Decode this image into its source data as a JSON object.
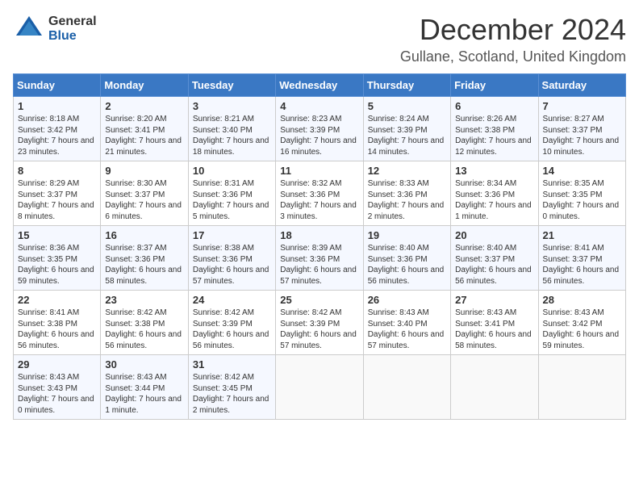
{
  "header": {
    "logo_general": "General",
    "logo_blue": "Blue",
    "title": "December 2024",
    "subtitle": "Gullane, Scotland, United Kingdom"
  },
  "calendar": {
    "days_of_week": [
      "Sunday",
      "Monday",
      "Tuesday",
      "Wednesday",
      "Thursday",
      "Friday",
      "Saturday"
    ],
    "weeks": [
      [
        {
          "day": "1",
          "sunrise": "Sunrise: 8:18 AM",
          "sunset": "Sunset: 3:42 PM",
          "daylight": "Daylight: 7 hours and 23 minutes."
        },
        {
          "day": "2",
          "sunrise": "Sunrise: 8:20 AM",
          "sunset": "Sunset: 3:41 PM",
          "daylight": "Daylight: 7 hours and 21 minutes."
        },
        {
          "day": "3",
          "sunrise": "Sunrise: 8:21 AM",
          "sunset": "Sunset: 3:40 PM",
          "daylight": "Daylight: 7 hours and 18 minutes."
        },
        {
          "day": "4",
          "sunrise": "Sunrise: 8:23 AM",
          "sunset": "Sunset: 3:39 PM",
          "daylight": "Daylight: 7 hours and 16 minutes."
        },
        {
          "day": "5",
          "sunrise": "Sunrise: 8:24 AM",
          "sunset": "Sunset: 3:39 PM",
          "daylight": "Daylight: 7 hours and 14 minutes."
        },
        {
          "day": "6",
          "sunrise": "Sunrise: 8:26 AM",
          "sunset": "Sunset: 3:38 PM",
          "daylight": "Daylight: 7 hours and 12 minutes."
        },
        {
          "day": "7",
          "sunrise": "Sunrise: 8:27 AM",
          "sunset": "Sunset: 3:37 PM",
          "daylight": "Daylight: 7 hours and 10 minutes."
        }
      ],
      [
        {
          "day": "8",
          "sunrise": "Sunrise: 8:29 AM",
          "sunset": "Sunset: 3:37 PM",
          "daylight": "Daylight: 7 hours and 8 minutes."
        },
        {
          "day": "9",
          "sunrise": "Sunrise: 8:30 AM",
          "sunset": "Sunset: 3:37 PM",
          "daylight": "Daylight: 7 hours and 6 minutes."
        },
        {
          "day": "10",
          "sunrise": "Sunrise: 8:31 AM",
          "sunset": "Sunset: 3:36 PM",
          "daylight": "Daylight: 7 hours and 5 minutes."
        },
        {
          "day": "11",
          "sunrise": "Sunrise: 8:32 AM",
          "sunset": "Sunset: 3:36 PM",
          "daylight": "Daylight: 7 hours and 3 minutes."
        },
        {
          "day": "12",
          "sunrise": "Sunrise: 8:33 AM",
          "sunset": "Sunset: 3:36 PM",
          "daylight": "Daylight: 7 hours and 2 minutes."
        },
        {
          "day": "13",
          "sunrise": "Sunrise: 8:34 AM",
          "sunset": "Sunset: 3:36 PM",
          "daylight": "Daylight: 7 hours and 1 minute."
        },
        {
          "day": "14",
          "sunrise": "Sunrise: 8:35 AM",
          "sunset": "Sunset: 3:35 PM",
          "daylight": "Daylight: 7 hours and 0 minutes."
        }
      ],
      [
        {
          "day": "15",
          "sunrise": "Sunrise: 8:36 AM",
          "sunset": "Sunset: 3:35 PM",
          "daylight": "Daylight: 6 hours and 59 minutes."
        },
        {
          "day": "16",
          "sunrise": "Sunrise: 8:37 AM",
          "sunset": "Sunset: 3:36 PM",
          "daylight": "Daylight: 6 hours and 58 minutes."
        },
        {
          "day": "17",
          "sunrise": "Sunrise: 8:38 AM",
          "sunset": "Sunset: 3:36 PM",
          "daylight": "Daylight: 6 hours and 57 minutes."
        },
        {
          "day": "18",
          "sunrise": "Sunrise: 8:39 AM",
          "sunset": "Sunset: 3:36 PM",
          "daylight": "Daylight: 6 hours and 57 minutes."
        },
        {
          "day": "19",
          "sunrise": "Sunrise: 8:40 AM",
          "sunset": "Sunset: 3:36 PM",
          "daylight": "Daylight: 6 hours and 56 minutes."
        },
        {
          "day": "20",
          "sunrise": "Sunrise: 8:40 AM",
          "sunset": "Sunset: 3:37 PM",
          "daylight": "Daylight: 6 hours and 56 minutes."
        },
        {
          "day": "21",
          "sunrise": "Sunrise: 8:41 AM",
          "sunset": "Sunset: 3:37 PM",
          "daylight": "Daylight: 6 hours and 56 minutes."
        }
      ],
      [
        {
          "day": "22",
          "sunrise": "Sunrise: 8:41 AM",
          "sunset": "Sunset: 3:38 PM",
          "daylight": "Daylight: 6 hours and 56 minutes."
        },
        {
          "day": "23",
          "sunrise": "Sunrise: 8:42 AM",
          "sunset": "Sunset: 3:38 PM",
          "daylight": "Daylight: 6 hours and 56 minutes."
        },
        {
          "day": "24",
          "sunrise": "Sunrise: 8:42 AM",
          "sunset": "Sunset: 3:39 PM",
          "daylight": "Daylight: 6 hours and 56 minutes."
        },
        {
          "day": "25",
          "sunrise": "Sunrise: 8:42 AM",
          "sunset": "Sunset: 3:39 PM",
          "daylight": "Daylight: 6 hours and 57 minutes."
        },
        {
          "day": "26",
          "sunrise": "Sunrise: 8:43 AM",
          "sunset": "Sunset: 3:40 PM",
          "daylight": "Daylight: 6 hours and 57 minutes."
        },
        {
          "day": "27",
          "sunrise": "Sunrise: 8:43 AM",
          "sunset": "Sunset: 3:41 PM",
          "daylight": "Daylight: 6 hours and 58 minutes."
        },
        {
          "day": "28",
          "sunrise": "Sunrise: 8:43 AM",
          "sunset": "Sunset: 3:42 PM",
          "daylight": "Daylight: 6 hours and 59 minutes."
        }
      ],
      [
        {
          "day": "29",
          "sunrise": "Sunrise: 8:43 AM",
          "sunset": "Sunset: 3:43 PM",
          "daylight": "Daylight: 7 hours and 0 minutes."
        },
        {
          "day": "30",
          "sunrise": "Sunrise: 8:43 AM",
          "sunset": "Sunset: 3:44 PM",
          "daylight": "Daylight: 7 hours and 1 minute."
        },
        {
          "day": "31",
          "sunrise": "Sunrise: 8:42 AM",
          "sunset": "Sunset: 3:45 PM",
          "daylight": "Daylight: 7 hours and 2 minutes."
        },
        null,
        null,
        null,
        null
      ]
    ]
  }
}
